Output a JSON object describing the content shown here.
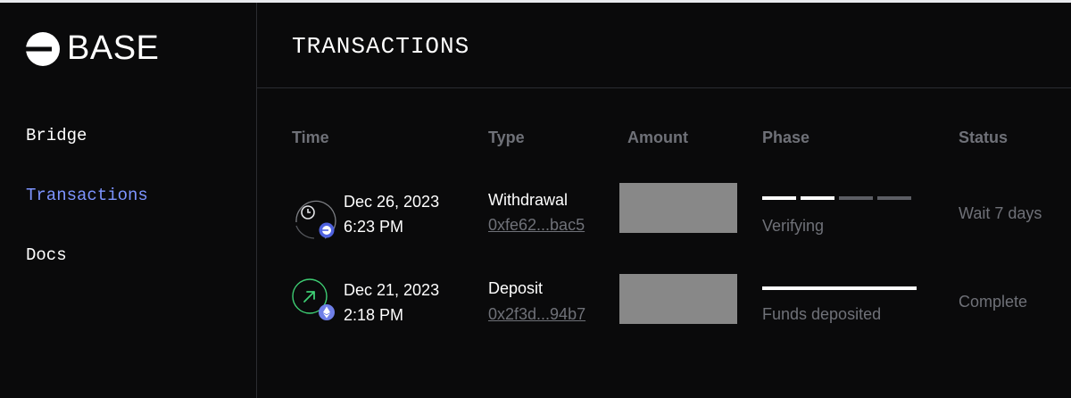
{
  "brand": {
    "name": "BASE"
  },
  "sidebar": {
    "items": [
      {
        "label": "Bridge",
        "active": false
      },
      {
        "label": "Transactions",
        "active": true
      },
      {
        "label": "Docs",
        "active": false
      }
    ]
  },
  "page": {
    "title": "TRANSACTIONS"
  },
  "table": {
    "headers": {
      "time": "Time",
      "type": "Type",
      "amount": "Amount",
      "phase": "Phase",
      "status": "Status"
    },
    "rows": [
      {
        "date": "Dec 26, 2023",
        "time": "6:23 PM",
        "type": "Withdrawal",
        "hash": "0xfe62...bac5",
        "phase_label": "Verifying",
        "phase_progress": "2 of 4",
        "status": "Wait 7 days",
        "icon": "clock-icon",
        "badge": "base-icon"
      },
      {
        "date": "Dec 21, 2023",
        "time": "2:18 PM",
        "type": "Deposit",
        "hash": "0x2f3d...94b7",
        "phase_label": "Funds deposited",
        "phase_progress": "complete",
        "status": "Complete",
        "icon": "arrow-up-right-icon",
        "badge": "ethereum-icon"
      }
    ]
  },
  "colors": {
    "accent": "#7d94ff",
    "muted": "#6f7178",
    "base_blue": "#0052ff",
    "eth_purple": "#6f7fe8",
    "success_green": "#3ecf74"
  }
}
